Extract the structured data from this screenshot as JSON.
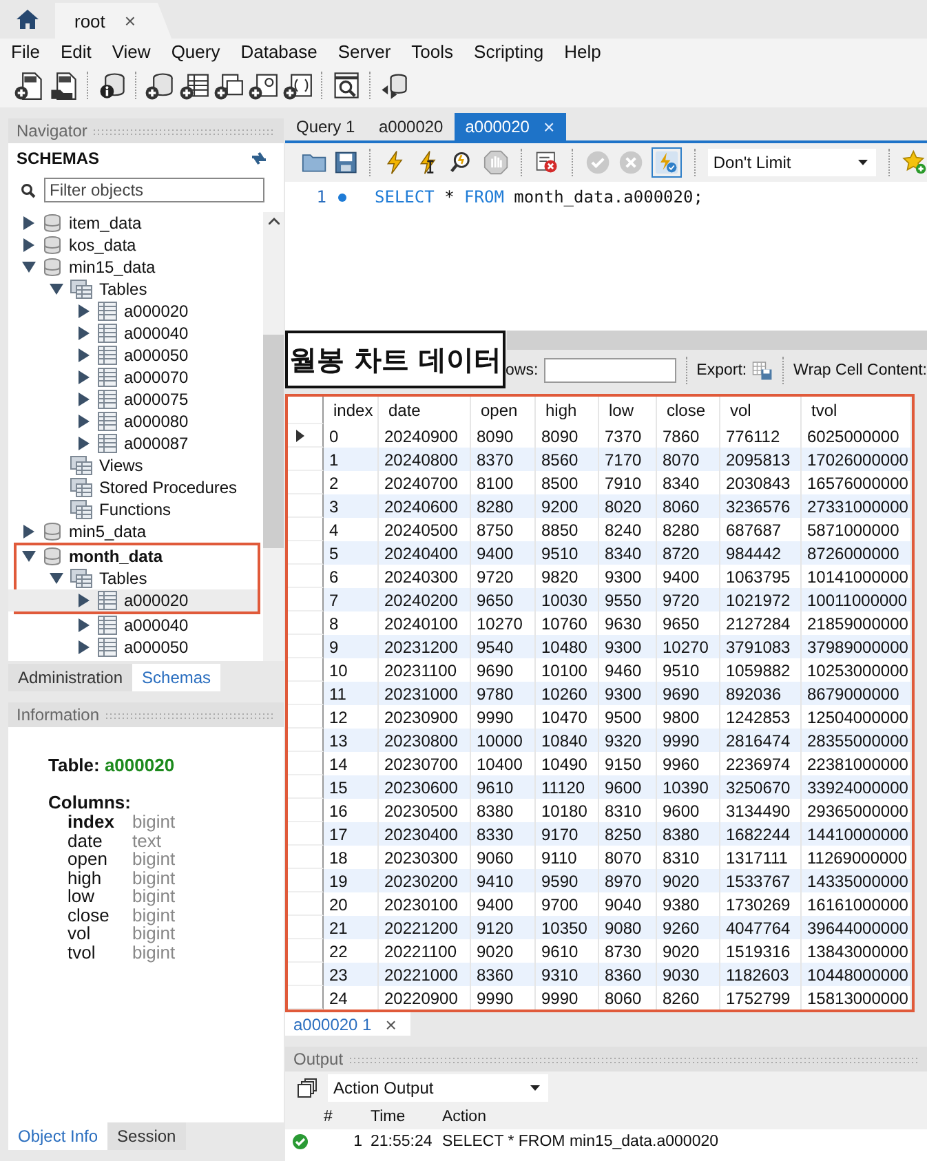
{
  "connection_tabs": [
    {
      "kind": "home"
    },
    {
      "kind": "connection",
      "label": "root",
      "close": "×",
      "selected": true
    }
  ],
  "menu": [
    "File",
    "Edit",
    "View",
    "Query",
    "Database",
    "Server",
    "Tools",
    "Scripting",
    "Help"
  ],
  "navigator": {
    "title": "Navigator",
    "schemas_label": "SCHEMAS",
    "filter_placeholder": "Filter objects",
    "tree": [
      {
        "label": "item_data",
        "kind": "schema",
        "expanded": false,
        "active": false,
        "selected": false,
        "annotated": false
      },
      {
        "label": "kos_data",
        "kind": "schema",
        "expanded": false,
        "active": false,
        "selected": false,
        "annotated": false
      },
      {
        "label": "min15_data",
        "kind": "schema",
        "expanded": true,
        "active": false,
        "selected": false,
        "annotated": false,
        "children": [
          {
            "label": "Tables",
            "kind": "folder",
            "expanded": true,
            "selected": false,
            "annotated": false,
            "children": [
              {
                "label": "a000020",
                "kind": "table",
                "expanded": false,
                "selected": false,
                "annotated": false
              },
              {
                "label": "a000040",
                "kind": "table",
                "expanded": false,
                "selected": false,
                "annotated": false
              },
              {
                "label": "a000050",
                "kind": "table",
                "expanded": false,
                "selected": false,
                "annotated": false
              },
              {
                "label": "a000070",
                "kind": "table",
                "expanded": false,
                "selected": false,
                "annotated": false
              },
              {
                "label": "a000075",
                "kind": "table",
                "expanded": false,
                "selected": false,
                "annotated": false
              },
              {
                "label": "a000080",
                "kind": "table",
                "expanded": false,
                "selected": false,
                "annotated": false
              },
              {
                "label": "a000087",
                "kind": "table",
                "expanded": false,
                "selected": false,
                "annotated": false
              }
            ]
          },
          {
            "label": "Views",
            "kind": "folder",
            "selected": false,
            "annotated": false
          },
          {
            "label": "Stored Procedures",
            "kind": "folder",
            "selected": false,
            "annotated": false
          },
          {
            "label": "Functions",
            "kind": "folder",
            "selected": false,
            "annotated": false
          }
        ]
      },
      {
        "label": "min5_data",
        "kind": "schema",
        "expanded": false,
        "active": false,
        "selected": false,
        "annotated": false
      },
      {
        "label": "month_data",
        "kind": "schema",
        "expanded": true,
        "active": true,
        "selected": false,
        "annotated": true,
        "children": [
          {
            "label": "Tables",
            "kind": "folder",
            "expanded": true,
            "selected": false,
            "annotated": true,
            "children": [
              {
                "label": "a000020",
                "kind": "table",
                "expanded": false,
                "selected": true,
                "annotated": true
              },
              {
                "label": "a000040",
                "kind": "table",
                "expanded": false,
                "selected": false,
                "annotated": false
              },
              {
                "label": "a000050",
                "kind": "table",
                "expanded": false,
                "selected": false,
                "annotated": false
              }
            ]
          }
        ]
      }
    ]
  },
  "sidebar_tabs": [
    {
      "label": "Administration",
      "selected": false
    },
    {
      "label": "Schemas",
      "selected": true
    }
  ],
  "information": {
    "title": "Information",
    "table_label": "Table:",
    "table_name": "a000020",
    "columns_label": "Columns:",
    "columns": [
      {
        "name": "index",
        "type": "bigint",
        "primary": true
      },
      {
        "name": "date",
        "type": "text",
        "primary": false
      },
      {
        "name": "open",
        "type": "bigint",
        "primary": false
      },
      {
        "name": "high",
        "type": "bigint",
        "primary": false
      },
      {
        "name": "low",
        "type": "bigint",
        "primary": false
      },
      {
        "name": "close",
        "type": "bigint",
        "primary": false
      },
      {
        "name": "vol",
        "type": "bigint",
        "primary": false
      },
      {
        "name": "tvol",
        "type": "bigint",
        "primary": false
      }
    ]
  },
  "info_tabs": [
    {
      "label": "Object Info",
      "selected": true
    },
    {
      "label": "Session",
      "selected": false
    }
  ],
  "editor_tabs": [
    {
      "label": "Query 1",
      "selected": false
    },
    {
      "label": "a000020",
      "selected": false
    },
    {
      "label": "a000020",
      "selected": true,
      "close": "×"
    }
  ],
  "editor_toolbar": {
    "commit_enabled": false,
    "rollback_enabled": false,
    "autocommit": true,
    "limit": "Don't Limit"
  },
  "code": [
    {
      "number": "1",
      "tokens": [
        {
          "kind": "keyword",
          "text": "SELECT"
        },
        {
          "kind": "plain",
          "text": " * "
        },
        {
          "kind": "keyword",
          "text": "FROM"
        },
        {
          "kind": "plain",
          "text": " month_data.a000020;"
        }
      ]
    }
  ],
  "annotation": {
    "label": "월봉 차트 데이터"
  },
  "result_toolbar": {
    "filter_label": "ows:",
    "export_label": "Export:",
    "wrap_label": "Wrap Cell Content:"
  },
  "result": {
    "columns": [
      "index",
      "date",
      "open",
      "high",
      "low",
      "close",
      "vol",
      "tvol"
    ],
    "rows": [
      {
        "current": true,
        "cells": [
          "0",
          "20240900",
          "8090",
          "8090",
          "7370",
          "7860",
          "776112",
          "6025000000"
        ]
      },
      {
        "current": false,
        "cells": [
          "1",
          "20240800",
          "8370",
          "8560",
          "7170",
          "8070",
          "2095813",
          "17026000000"
        ]
      },
      {
        "current": false,
        "cells": [
          "2",
          "20240700",
          "8100",
          "8500",
          "7910",
          "8340",
          "2030843",
          "16576000000"
        ]
      },
      {
        "current": false,
        "cells": [
          "3",
          "20240600",
          "8280",
          "9200",
          "8020",
          "8060",
          "3236576",
          "27331000000"
        ]
      },
      {
        "current": false,
        "cells": [
          "4",
          "20240500",
          "8750",
          "8850",
          "8240",
          "8280",
          "687687",
          "5871000000"
        ]
      },
      {
        "current": false,
        "cells": [
          "5",
          "20240400",
          "9400",
          "9510",
          "8340",
          "8720",
          "984442",
          "8726000000"
        ]
      },
      {
        "current": false,
        "cells": [
          "6",
          "20240300",
          "9720",
          "9820",
          "9300",
          "9400",
          "1063795",
          "10141000000"
        ]
      },
      {
        "current": false,
        "cells": [
          "7",
          "20240200",
          "9650",
          "10030",
          "9550",
          "9720",
          "1021972",
          "10011000000"
        ]
      },
      {
        "current": false,
        "cells": [
          "8",
          "20240100",
          "10270",
          "10760",
          "9630",
          "9650",
          "2127284",
          "21859000000"
        ]
      },
      {
        "current": false,
        "cells": [
          "9",
          "20231200",
          "9540",
          "10480",
          "9300",
          "10270",
          "3791083",
          "37989000000"
        ]
      },
      {
        "current": false,
        "cells": [
          "10",
          "20231100",
          "9690",
          "10100",
          "9460",
          "9510",
          "1059882",
          "10253000000"
        ]
      },
      {
        "current": false,
        "cells": [
          "11",
          "20231000",
          "9780",
          "10260",
          "9300",
          "9690",
          "892036",
          "8679000000"
        ]
      },
      {
        "current": false,
        "cells": [
          "12",
          "20230900",
          "9990",
          "10470",
          "9500",
          "9800",
          "1242853",
          "12504000000"
        ]
      },
      {
        "current": false,
        "cells": [
          "13",
          "20230800",
          "10000",
          "10840",
          "9320",
          "9990",
          "2816474",
          "28355000000"
        ]
      },
      {
        "current": false,
        "cells": [
          "14",
          "20230700",
          "10400",
          "10490",
          "9150",
          "9960",
          "2236974",
          "22381000000"
        ]
      },
      {
        "current": false,
        "cells": [
          "15",
          "20230600",
          "9610",
          "11120",
          "9600",
          "10390",
          "3250670",
          "33924000000"
        ]
      },
      {
        "current": false,
        "cells": [
          "16",
          "20230500",
          "8380",
          "10180",
          "8310",
          "9600",
          "3134490",
          "29365000000"
        ]
      },
      {
        "current": false,
        "cells": [
          "17",
          "20230400",
          "8330",
          "9170",
          "8250",
          "8380",
          "1682244",
          "14410000000"
        ]
      },
      {
        "current": false,
        "cells": [
          "18",
          "20230300",
          "9060",
          "9110",
          "8070",
          "8310",
          "1317111",
          "11269000000"
        ]
      },
      {
        "current": false,
        "cells": [
          "19",
          "20230200",
          "9410",
          "9590",
          "8970",
          "9020",
          "1533767",
          "14335000000"
        ]
      },
      {
        "current": false,
        "cells": [
          "20",
          "20230100",
          "9400",
          "9700",
          "9040",
          "9380",
          "1730269",
          "16161000000"
        ]
      },
      {
        "current": false,
        "cells": [
          "21",
          "20221200",
          "9120",
          "10350",
          "9080",
          "9260",
          "4047764",
          "39644000000"
        ]
      },
      {
        "current": false,
        "cells": [
          "22",
          "20221100",
          "9020",
          "9610",
          "8730",
          "9020",
          "1519316",
          "13843000000"
        ]
      },
      {
        "current": false,
        "cells": [
          "23",
          "20221000",
          "8360",
          "9310",
          "8360",
          "9030",
          "1182603",
          "10448000000"
        ]
      },
      {
        "current": false,
        "cells": [
          "24",
          "20220900",
          "9990",
          "9990",
          "8060",
          "8260",
          "1752799",
          "15813000000"
        ]
      }
    ]
  },
  "result_tabs": [
    {
      "label": "a000020 1",
      "close": "×",
      "selected": true
    }
  ],
  "output": {
    "title": "Output",
    "mode": "Action Output",
    "columns": [
      "#",
      "Time",
      "Action"
    ],
    "entries": [
      {
        "kind": "success",
        "number": "1",
        "time": "21:55:24",
        "action": "SELECT * FROM min15_data.a000020"
      }
    ]
  }
}
